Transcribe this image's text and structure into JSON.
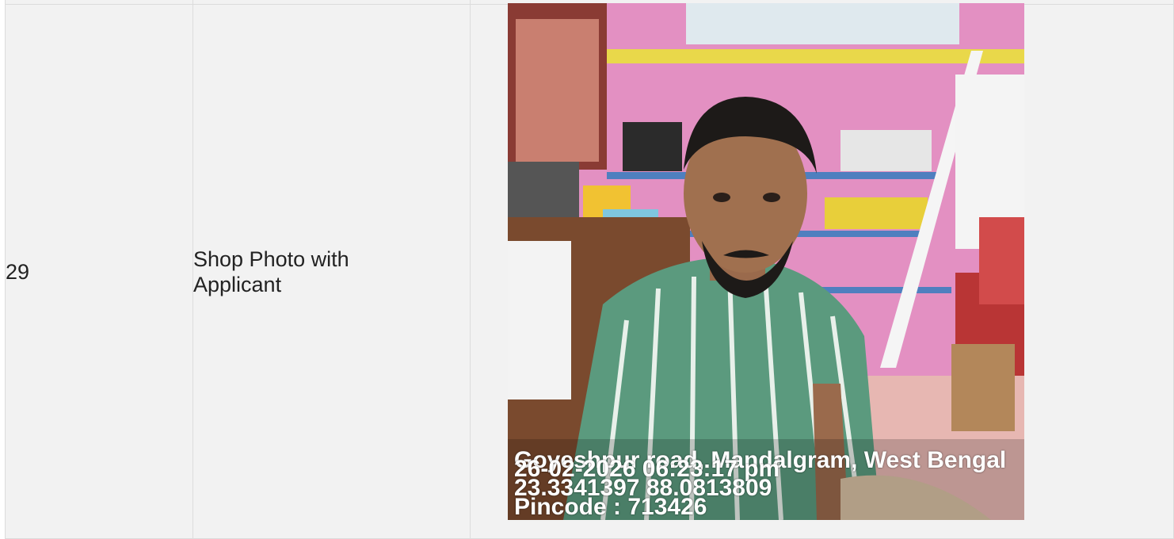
{
  "row": {
    "sl_no": "29",
    "label": "Shop Photo with Applicant"
  },
  "photo": {
    "icon": "photo-applicant-shop",
    "overlay": {
      "location": "Goyeshpur road, Mandalgram, West Bengal",
      "datetime": "26-02-2026 06:23:17 pm",
      "coords": "23.3341397 88.0813809",
      "pincode": "Pincode : 713426"
    }
  },
  "colors": {
    "cell_bg": "#f2f2f2",
    "border": "#dcdcdc",
    "text": "#222222",
    "wall_pink": "#e08fbf",
    "shirt_green": "#5b9a7e"
  }
}
